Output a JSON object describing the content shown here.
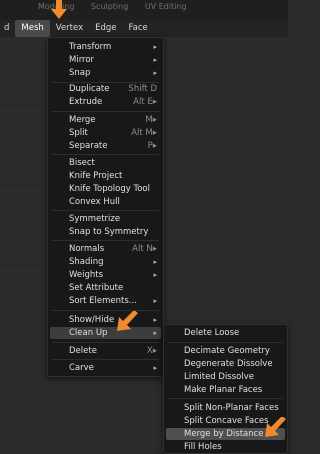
{
  "top_tabs": [
    "Modeling",
    "Sculpting",
    "UV Editing"
  ],
  "header": {
    "items": [
      "d",
      "Mesh",
      "Vertex",
      "Edge",
      "Face"
    ]
  },
  "mesh_menu": [
    {
      "label": "Transform",
      "arrow": "▸"
    },
    {
      "label": "Mirror",
      "arrow": "▸"
    },
    {
      "label": "Snap",
      "arrow": "▸"
    },
    {
      "label": "Duplicate",
      "shortcut": "Shift D"
    },
    {
      "label": "Extrude",
      "shortcut": "Alt E▸"
    },
    {
      "label": "Merge",
      "shortcut": "M▸"
    },
    {
      "label": "Split",
      "shortcut": "Alt M▸"
    },
    {
      "label": "Separate",
      "shortcut": "P▸"
    },
    {
      "label": "Bisect"
    },
    {
      "label": "Knife Project"
    },
    {
      "label": "Knife Topology Tool"
    },
    {
      "label": "Convex Hull"
    },
    {
      "label": "Symmetrize"
    },
    {
      "label": "Snap to Symmetry"
    },
    {
      "label": "Normals",
      "shortcut": "Alt N▸"
    },
    {
      "label": "Shading",
      "arrow": "▸"
    },
    {
      "label": "Weights",
      "arrow": "▸"
    },
    {
      "label": "Set Attribute"
    },
    {
      "label": "Sort Elements...",
      "arrow": "▸"
    },
    {
      "label": "Show/Hide",
      "arrow": "▸"
    },
    {
      "label": "Clean Up",
      "arrow": "▸"
    },
    {
      "label": "Delete",
      "shortcut": "X▸"
    },
    {
      "label": "Carve",
      "arrow": "▸"
    }
  ],
  "cleanup_menu": [
    {
      "label": "Delete Loose"
    },
    {
      "label": "Decimate Geometry"
    },
    {
      "label": "Degenerate Dissolve"
    },
    {
      "label": "Limited Dissolve"
    },
    {
      "label": "Make Planar Faces"
    },
    {
      "label": "Split Non-Planar Faces"
    },
    {
      "label": "Split Concave Faces"
    },
    {
      "label": "Merge by Distance"
    },
    {
      "label": "Fill Holes"
    }
  ],
  "colors": {
    "annotation_arrow": "#f08a2c",
    "highlight": "#4f4f4f"
  }
}
